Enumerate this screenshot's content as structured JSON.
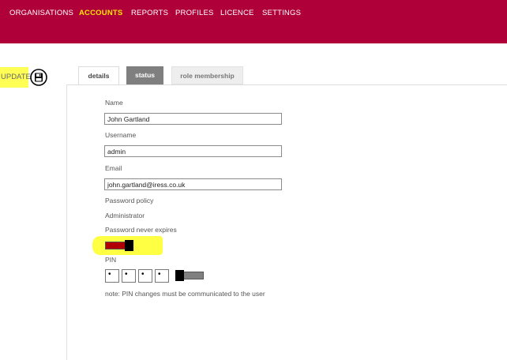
{
  "nav": {
    "items": [
      {
        "label": "ORGANISATIONS"
      },
      {
        "label": "ACCOUNTS",
        "active": true
      },
      {
        "label": "REPORTS"
      },
      {
        "label": "PROFILES"
      },
      {
        "label": "LICENCE"
      },
      {
        "label": "SETTINGS"
      }
    ]
  },
  "toolbar": {
    "update_label": "UPDATE",
    "save_icon": "floppy-disk-icon"
  },
  "tabs": [
    {
      "label": "details",
      "active": true
    },
    {
      "label": "status"
    },
    {
      "label": "role membership"
    }
  ],
  "form": {
    "name": {
      "label": "Name",
      "value": "John Gartland"
    },
    "username": {
      "label": "Username",
      "value": "admin"
    },
    "email": {
      "label": "Email",
      "value": "john.gartland@iress.co.uk"
    },
    "password_policy_label": "Password policy",
    "administrator_label": "Administrator",
    "password_never_expires": {
      "label": "Password never expires",
      "on": true
    },
    "pin": {
      "label": "PIN",
      "digits": [
        "•",
        "•",
        "•",
        "•"
      ],
      "toggle_on": false
    },
    "note": "note: PIN changes must be communicated to the user"
  },
  "colors": {
    "header": "#b0003a",
    "nav_active": "#ffe600",
    "highlight": "#ffff44",
    "toggle_on": "#b00000",
    "toggle_off": "#808080"
  }
}
